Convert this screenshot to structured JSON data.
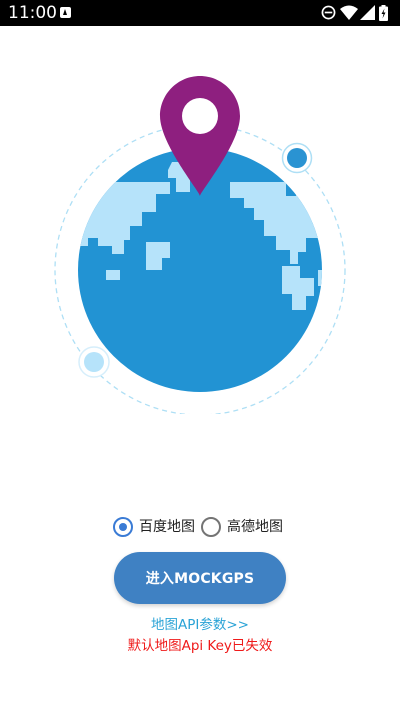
{
  "status_bar": {
    "time": "11:00",
    "icons": [
      "app-notification-icon",
      "do-not-disturb-icon",
      "wifi-icon",
      "signal-icon",
      "battery-charging-icon"
    ]
  },
  "illustration": {
    "description_icons": [
      "globe-icon",
      "location-pin-icon",
      "orbit-dot-icon"
    ],
    "colors": {
      "ocean": "#2293d3",
      "land": "#b6e3fa",
      "pin": "#8e1f7f",
      "orbit": "#aedff5"
    }
  },
  "map_options": {
    "selected": "baidu",
    "items": [
      {
        "id": "baidu",
        "label": "百度地图",
        "checked": true
      },
      {
        "id": "gaode",
        "label": "高德地图",
        "checked": false
      }
    ]
  },
  "enter_button": {
    "label": "进入MOCKGPS"
  },
  "api_params_link": {
    "label": "地图API参数>>"
  },
  "key_status": {
    "label": "默认地图Api Key已失效"
  },
  "colors": {
    "accent": "#3f81c3",
    "link": "#2aa3d6",
    "error": "#ef1a1a"
  }
}
